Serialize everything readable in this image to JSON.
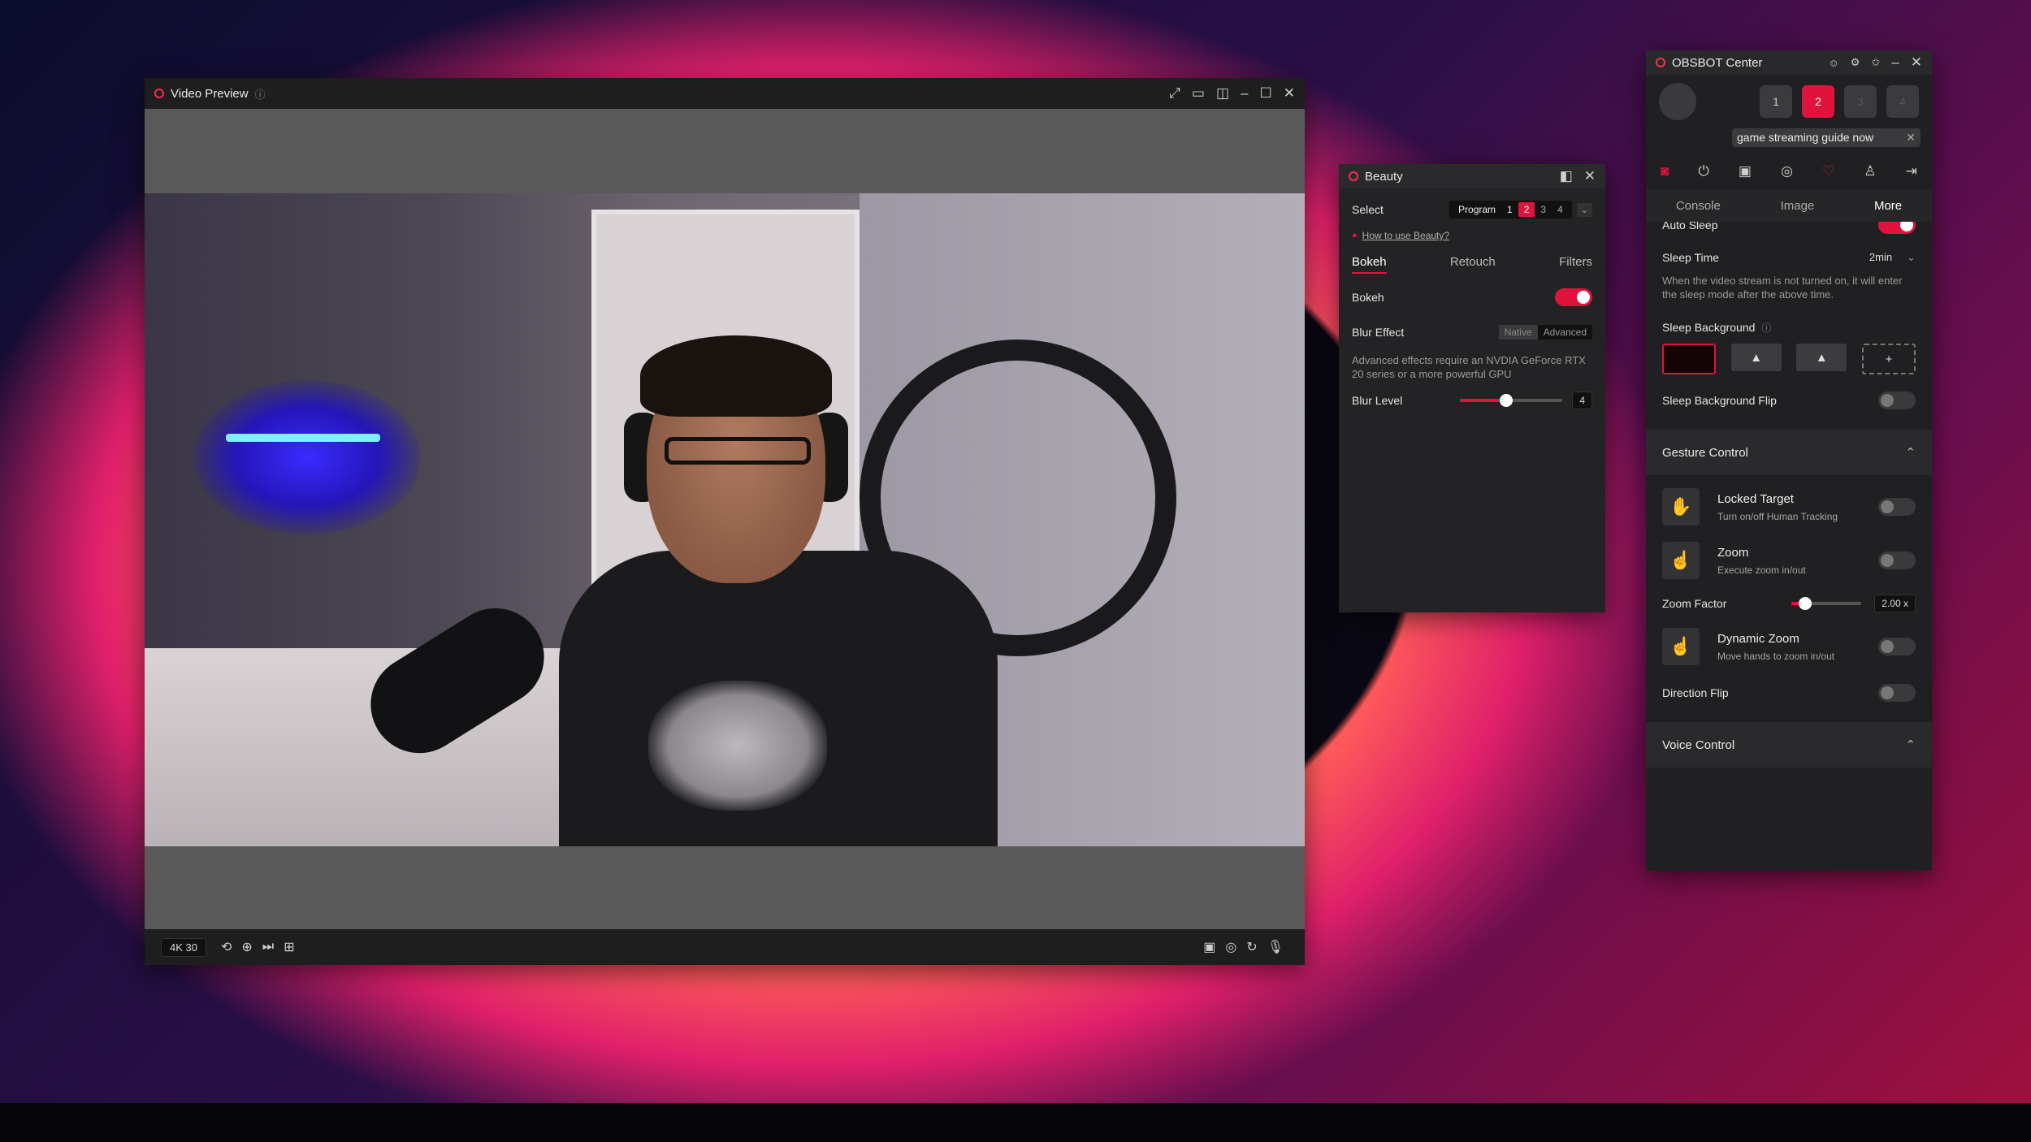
{
  "video_preview": {
    "title": "Video Preview",
    "resolution": "4K 30",
    "controls": [
      "expand-icon",
      "single-view-icon",
      "split-view-icon",
      "minimize-icon",
      "maximize-icon",
      "close-icon"
    ]
  },
  "beauty": {
    "title": "Beauty",
    "select_label": "Select",
    "select_options": [
      "Program",
      "1",
      "2",
      "3",
      "4"
    ],
    "select_active": "2",
    "help_link": "How to use Beauty?",
    "tabs": [
      "Bokeh",
      "Retouch",
      "Filters"
    ],
    "active_tab": "Bokeh",
    "bokeh_label": "Bokeh",
    "bokeh_on": true,
    "blur_effect_label": "Blur Effect",
    "blur_effect_options": [
      "Native",
      "Advanced"
    ],
    "advanced_note": "Advanced effects require an NVDIA GeForce RTX 20 series or a more powerful GPU",
    "blur_level_label": "Blur Level",
    "blur_level_value": "4",
    "blur_level_fraction": 0.45
  },
  "obsbot": {
    "title": "OBSBOT Center",
    "devices": [
      "1",
      "2",
      "3",
      "4"
    ],
    "active_device": "2",
    "notice": "game streaming guide now",
    "subtabs": [
      "Console",
      "Image",
      "More"
    ],
    "active_subtab": "More",
    "auto_sleep_label": "Auto Sleep",
    "sleep_time_label": "Sleep Time",
    "sleep_time_value": "2min",
    "sleep_desc": "When the video stream is not turned on, it will enter the sleep mode after the above time.",
    "sleep_background_label": "Sleep Background",
    "sleep_background_flip_label": "Sleep Background Flip",
    "gesture_control_label": "Gesture Control",
    "gestures": [
      {
        "title": "Locked Target",
        "desc": "Turn on/off Human Tracking"
      },
      {
        "title": "Zoom",
        "desc": "Execute zoom in/out"
      },
      {
        "title": "Dynamic Zoom",
        "desc": "Move hands to zoom in/out"
      }
    ],
    "zoom_factor_label": "Zoom Factor",
    "zoom_factor_value": "2.00 x",
    "zoom_factor_fraction": 0.2,
    "direction_flip_label": "Direction Flip",
    "voice_control_label": "Voice Control"
  },
  "colors": {
    "accent": "#e0133d"
  }
}
